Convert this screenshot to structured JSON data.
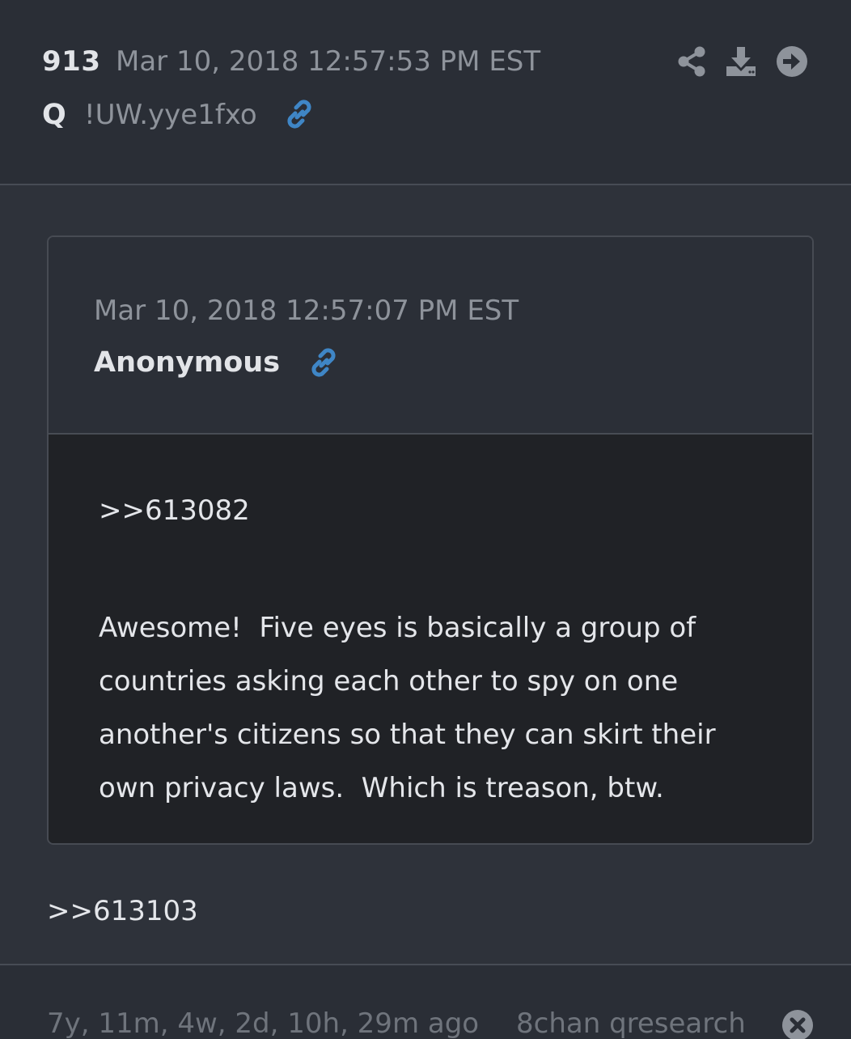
{
  "post": {
    "number": "913",
    "date": "Mar 10, 2018 12:57:53 PM EST",
    "author": "Q",
    "tripcode": "!UW.yye1fxo",
    "reply_ref": ">>613103"
  },
  "header_icons": {
    "share": "share-icon",
    "download": "download-icon",
    "next": "arrow-right-circle-icon",
    "link": "link-icon"
  },
  "quoted": {
    "date": "Mar 10, 2018 12:57:07 PM EST",
    "author": "Anonymous",
    "ref": ">>613082",
    "text": "Awesome!  Five eyes is basically a group of\ncountries asking each other to spy on one\nanother's citizens so that they can skirt their\nown privacy laws.  Which is treason, btw."
  },
  "footer": {
    "age": "7y, 11m, 4w, 2d, 10h, 29m ago",
    "source": "8chan qresearch",
    "close_icon": "close-circle-icon"
  },
  "colors": {
    "background": "#2e323a",
    "link_accent": "#3f86c6",
    "muted_text": "#8e939b",
    "quote_body": "#202226"
  }
}
